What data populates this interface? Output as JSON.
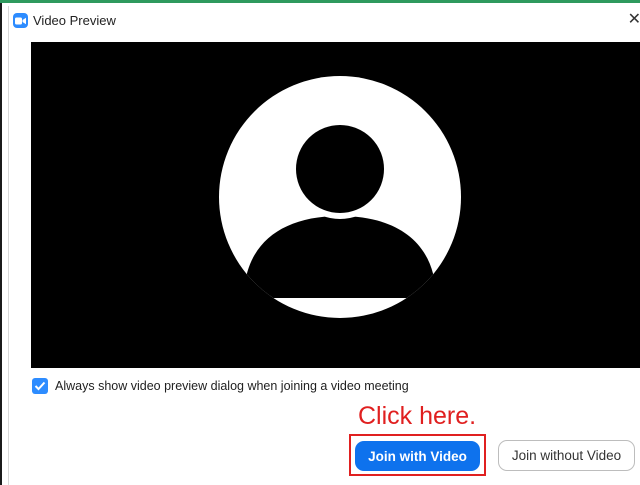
{
  "window": {
    "title": "Video Preview",
    "close_glyph": "✕"
  },
  "icons": {
    "app": "zoom-camera-icon",
    "close": "close-icon",
    "avatar": "user-silhouette-icon",
    "checkmark": "checkmark-icon"
  },
  "preview": {
    "always_show_checked": true,
    "always_show_label": "Always show video preview dialog when joining a video meeting"
  },
  "annotation": {
    "text": "Click here."
  },
  "buttons": {
    "join_with_video": "Join with Video",
    "join_without_video": "Join without Video"
  },
  "colors": {
    "accent": "#0e72ed",
    "checkbox": "#2d8cff",
    "annotation": "#e02020",
    "video_background": "#000000",
    "top_rule": "#2e9a5e"
  }
}
